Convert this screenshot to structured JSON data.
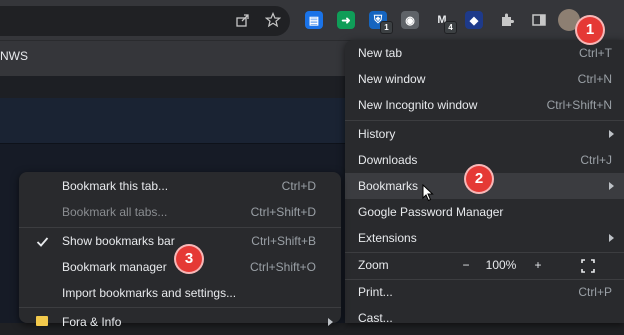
{
  "bookmarks_bar": {
    "visible_item": "NWS"
  },
  "toolbar": {
    "share_icon": "share-icon",
    "star_icon": "bookmark-star-icon",
    "extension_badges": [
      "1",
      "4"
    ]
  },
  "main_menu": {
    "items": [
      {
        "label": "New tab",
        "shortcut": "Ctrl+T"
      },
      {
        "label": "New window",
        "shortcut": "Ctrl+N"
      },
      {
        "label": "New Incognito window",
        "shortcut": "Ctrl+Shift+N"
      },
      {
        "label": "History",
        "shortcut": ""
      },
      {
        "label": "Downloads",
        "shortcut": "Ctrl+J"
      },
      {
        "label": "Bookmarks",
        "shortcut": ""
      },
      {
        "label": "Google Password Manager",
        "shortcut": ""
      },
      {
        "label": "Extensions",
        "shortcut": ""
      },
      {
        "label": "Zoom",
        "shortcut": ""
      },
      {
        "label": "Print...",
        "shortcut": "Ctrl+P"
      },
      {
        "label": "Cast...",
        "shortcut": ""
      }
    ],
    "zoom": {
      "minus": "−",
      "value": "100%",
      "plus": "+"
    }
  },
  "bookmarks_submenu": {
    "items": [
      {
        "label": "Bookmark this tab...",
        "shortcut": "Ctrl+D"
      },
      {
        "label": "Bookmark all tabs...",
        "shortcut": "Ctrl+Shift+D"
      },
      {
        "label": "Show bookmarks bar",
        "shortcut": "Ctrl+Shift+B"
      },
      {
        "label": "Bookmark manager",
        "shortcut": "Ctrl+Shift+O"
      },
      {
        "label": "Import bookmarks and settings...",
        "shortcut": ""
      },
      {
        "label": "Fora & Info",
        "shortcut": ""
      }
    ],
    "checked_item": "Show bookmarks bar"
  },
  "callouts": [
    "1",
    "2",
    "3"
  ],
  "colors": {
    "menu_bg": "#292a2d",
    "callout": "#e53935",
    "highlight": "#3b3c40"
  }
}
